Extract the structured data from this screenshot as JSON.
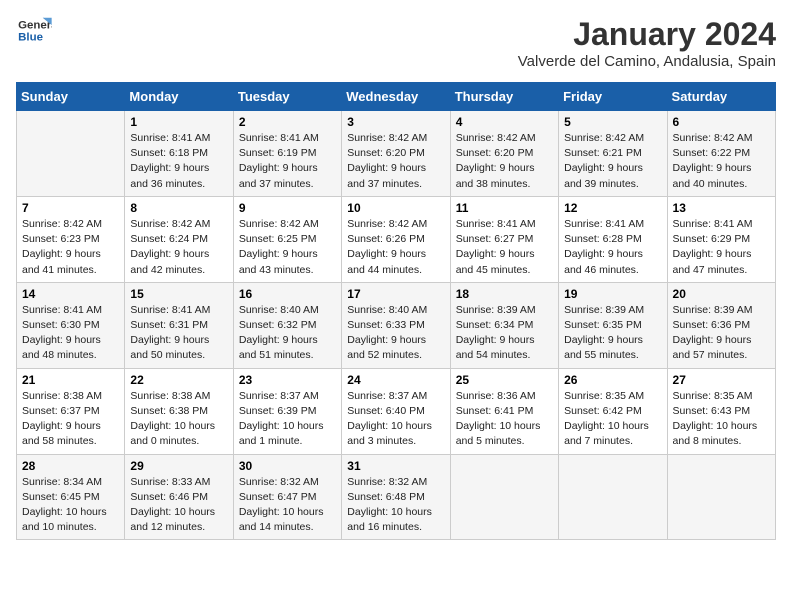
{
  "logo": {
    "line1": "General",
    "line2": "Blue"
  },
  "title": "January 2024",
  "location": "Valverde del Camino, Andalusia, Spain",
  "weekdays": [
    "Sunday",
    "Monday",
    "Tuesday",
    "Wednesday",
    "Thursday",
    "Friday",
    "Saturday"
  ],
  "weeks": [
    [
      {
        "day": "",
        "info": ""
      },
      {
        "day": "1",
        "info": "Sunrise: 8:41 AM\nSunset: 6:18 PM\nDaylight: 9 hours\nand 36 minutes."
      },
      {
        "day": "2",
        "info": "Sunrise: 8:41 AM\nSunset: 6:19 PM\nDaylight: 9 hours\nand 37 minutes."
      },
      {
        "day": "3",
        "info": "Sunrise: 8:42 AM\nSunset: 6:20 PM\nDaylight: 9 hours\nand 37 minutes."
      },
      {
        "day": "4",
        "info": "Sunrise: 8:42 AM\nSunset: 6:20 PM\nDaylight: 9 hours\nand 38 minutes."
      },
      {
        "day": "5",
        "info": "Sunrise: 8:42 AM\nSunset: 6:21 PM\nDaylight: 9 hours\nand 39 minutes."
      },
      {
        "day": "6",
        "info": "Sunrise: 8:42 AM\nSunset: 6:22 PM\nDaylight: 9 hours\nand 40 minutes."
      }
    ],
    [
      {
        "day": "7",
        "info": "Sunrise: 8:42 AM\nSunset: 6:23 PM\nDaylight: 9 hours\nand 41 minutes."
      },
      {
        "day": "8",
        "info": "Sunrise: 8:42 AM\nSunset: 6:24 PM\nDaylight: 9 hours\nand 42 minutes."
      },
      {
        "day": "9",
        "info": "Sunrise: 8:42 AM\nSunset: 6:25 PM\nDaylight: 9 hours\nand 43 minutes."
      },
      {
        "day": "10",
        "info": "Sunrise: 8:42 AM\nSunset: 6:26 PM\nDaylight: 9 hours\nand 44 minutes."
      },
      {
        "day": "11",
        "info": "Sunrise: 8:41 AM\nSunset: 6:27 PM\nDaylight: 9 hours\nand 45 minutes."
      },
      {
        "day": "12",
        "info": "Sunrise: 8:41 AM\nSunset: 6:28 PM\nDaylight: 9 hours\nand 46 minutes."
      },
      {
        "day": "13",
        "info": "Sunrise: 8:41 AM\nSunset: 6:29 PM\nDaylight: 9 hours\nand 47 minutes."
      }
    ],
    [
      {
        "day": "14",
        "info": "Sunrise: 8:41 AM\nSunset: 6:30 PM\nDaylight: 9 hours\nand 48 minutes."
      },
      {
        "day": "15",
        "info": "Sunrise: 8:41 AM\nSunset: 6:31 PM\nDaylight: 9 hours\nand 50 minutes."
      },
      {
        "day": "16",
        "info": "Sunrise: 8:40 AM\nSunset: 6:32 PM\nDaylight: 9 hours\nand 51 minutes."
      },
      {
        "day": "17",
        "info": "Sunrise: 8:40 AM\nSunset: 6:33 PM\nDaylight: 9 hours\nand 52 minutes."
      },
      {
        "day": "18",
        "info": "Sunrise: 8:39 AM\nSunset: 6:34 PM\nDaylight: 9 hours\nand 54 minutes."
      },
      {
        "day": "19",
        "info": "Sunrise: 8:39 AM\nSunset: 6:35 PM\nDaylight: 9 hours\nand 55 minutes."
      },
      {
        "day": "20",
        "info": "Sunrise: 8:39 AM\nSunset: 6:36 PM\nDaylight: 9 hours\nand 57 minutes."
      }
    ],
    [
      {
        "day": "21",
        "info": "Sunrise: 8:38 AM\nSunset: 6:37 PM\nDaylight: 9 hours\nand 58 minutes."
      },
      {
        "day": "22",
        "info": "Sunrise: 8:38 AM\nSunset: 6:38 PM\nDaylight: 10 hours\nand 0 minutes."
      },
      {
        "day": "23",
        "info": "Sunrise: 8:37 AM\nSunset: 6:39 PM\nDaylight: 10 hours\nand 1 minute."
      },
      {
        "day": "24",
        "info": "Sunrise: 8:37 AM\nSunset: 6:40 PM\nDaylight: 10 hours\nand 3 minutes."
      },
      {
        "day": "25",
        "info": "Sunrise: 8:36 AM\nSunset: 6:41 PM\nDaylight: 10 hours\nand 5 minutes."
      },
      {
        "day": "26",
        "info": "Sunrise: 8:35 AM\nSunset: 6:42 PM\nDaylight: 10 hours\nand 7 minutes."
      },
      {
        "day": "27",
        "info": "Sunrise: 8:35 AM\nSunset: 6:43 PM\nDaylight: 10 hours\nand 8 minutes."
      }
    ],
    [
      {
        "day": "28",
        "info": "Sunrise: 8:34 AM\nSunset: 6:45 PM\nDaylight: 10 hours\nand 10 minutes."
      },
      {
        "day": "29",
        "info": "Sunrise: 8:33 AM\nSunset: 6:46 PM\nDaylight: 10 hours\nand 12 minutes."
      },
      {
        "day": "30",
        "info": "Sunrise: 8:32 AM\nSunset: 6:47 PM\nDaylight: 10 hours\nand 14 minutes."
      },
      {
        "day": "31",
        "info": "Sunrise: 8:32 AM\nSunset: 6:48 PM\nDaylight: 10 hours\nand 16 minutes."
      },
      {
        "day": "",
        "info": ""
      },
      {
        "day": "",
        "info": ""
      },
      {
        "day": "",
        "info": ""
      }
    ]
  ]
}
